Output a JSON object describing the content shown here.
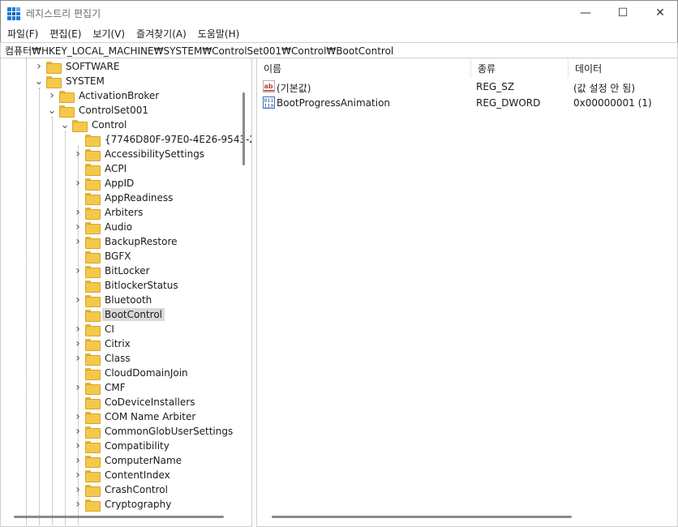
{
  "window": {
    "title": "레지스트리 편집기",
    "controls": {
      "minimize": "—",
      "maximize": "☐",
      "close": "✕"
    }
  },
  "menu": [
    "파일(F)",
    "편집(E)",
    "보기(V)",
    "즐겨찾기(A)",
    "도움말(H)"
  ],
  "address": "컴퓨터₩HKEY_LOCAL_MACHINE₩SYSTEM₩ControlSet001₩Control₩BootControl",
  "tree": [
    {
      "label": "SOFTWARE",
      "expander": "collapsed"
    },
    {
      "label": "SYSTEM",
      "expander": "expanded"
    },
    {
      "label": "ActivationBroker",
      "expander": "collapsed"
    },
    {
      "label": "ControlSet001",
      "expander": "expanded"
    },
    {
      "label": "Control",
      "expander": "expanded"
    },
    {
      "label": "{7746D80F-97E0-4E26-9543-2",
      "expander": "none"
    },
    {
      "label": "AccessibilitySettings",
      "expander": "collapsed"
    },
    {
      "label": "ACPI",
      "expander": "none"
    },
    {
      "label": "AppID",
      "expander": "collapsed"
    },
    {
      "label": "AppReadiness",
      "expander": "none"
    },
    {
      "label": "Arbiters",
      "expander": "collapsed"
    },
    {
      "label": "Audio",
      "expander": "collapsed"
    },
    {
      "label": "BackupRestore",
      "expander": "collapsed"
    },
    {
      "label": "BGFX",
      "expander": "none"
    },
    {
      "label": "BitLocker",
      "expander": "collapsed"
    },
    {
      "label": "BitlockerStatus",
      "expander": "none"
    },
    {
      "label": "Bluetooth",
      "expander": "collapsed"
    },
    {
      "label": "BootControl",
      "expander": "none",
      "selected": true
    },
    {
      "label": "CI",
      "expander": "collapsed"
    },
    {
      "label": "Citrix",
      "expander": "collapsed"
    },
    {
      "label": "Class",
      "expander": "collapsed"
    },
    {
      "label": "CloudDomainJoin",
      "expander": "none"
    },
    {
      "label": "CMF",
      "expander": "collapsed"
    },
    {
      "label": "CoDeviceInstallers",
      "expander": "none"
    },
    {
      "label": "COM Name Arbiter",
      "expander": "collapsed"
    },
    {
      "label": "CommonGlobUserSettings",
      "expander": "collapsed"
    },
    {
      "label": "Compatibility",
      "expander": "collapsed"
    },
    {
      "label": "ComputerName",
      "expander": "collapsed"
    },
    {
      "label": "ContentIndex",
      "expander": "collapsed"
    },
    {
      "label": "CrashControl",
      "expander": "collapsed"
    },
    {
      "label": "Cryptography",
      "expander": "collapsed"
    }
  ],
  "columns": {
    "name": "이름",
    "type": "종류",
    "data": "데이터"
  },
  "values": [
    {
      "icon": "string-value-icon",
      "name": "(기본값)",
      "type": "REG_SZ",
      "data": "(값 설정 안 됨)"
    },
    {
      "icon": "binary-value-icon",
      "name": "BootProgressAnimation",
      "type": "REG_DWORD",
      "data": "0x00000001 (1)"
    }
  ],
  "colors": {
    "folder": "#f5c84a",
    "selection": "#d9d9d9",
    "accent": "#1e78d6"
  }
}
